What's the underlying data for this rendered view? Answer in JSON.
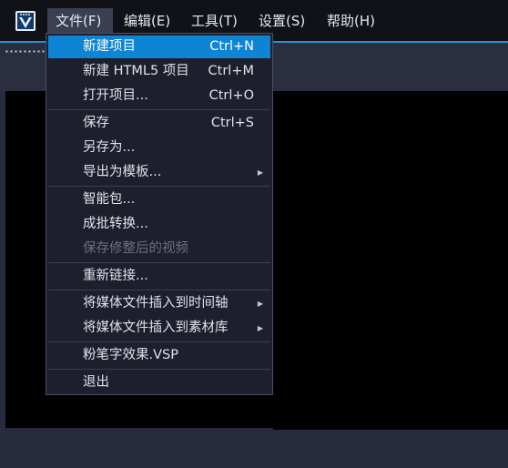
{
  "menubar": {
    "items": [
      {
        "label": "文件(F)"
      },
      {
        "label": "编辑(E)"
      },
      {
        "label": "工具(T)"
      },
      {
        "label": "设置(S)"
      },
      {
        "label": "帮助(H)"
      }
    ]
  },
  "file_menu": {
    "groups": [
      [
        {
          "label": "新建项目",
          "shortcut": "Ctrl+N"
        },
        {
          "label": "新建 HTML5 项目",
          "shortcut": "Ctrl+M"
        },
        {
          "label": "打开项目...",
          "shortcut": "Ctrl+O"
        }
      ],
      [
        {
          "label": "保存",
          "shortcut": "Ctrl+S"
        },
        {
          "label": "另存为..."
        },
        {
          "label": "导出为模板..."
        }
      ],
      [
        {
          "label": "智能包..."
        },
        {
          "label": "成批转换..."
        },
        {
          "label": "保存修整后的视频"
        }
      ],
      [
        {
          "label": "重新链接..."
        }
      ],
      [
        {
          "label": "将媒体文件插入到时间轴"
        },
        {
          "label": "将媒体文件插入到素材库"
        }
      ],
      [
        {
          "label": "粉笔字效果.VSP"
        }
      ],
      [
        {
          "label": "退出"
        }
      ]
    ]
  },
  "colors": {
    "accent": "#0e85d4",
    "menubar_bg": "#101218",
    "menu_bg": "#1d202c",
    "disabled_text": "#6b7082"
  },
  "icons": {
    "app_logo": "app-logo-icon",
    "submenu": "chevron-right-icon"
  }
}
